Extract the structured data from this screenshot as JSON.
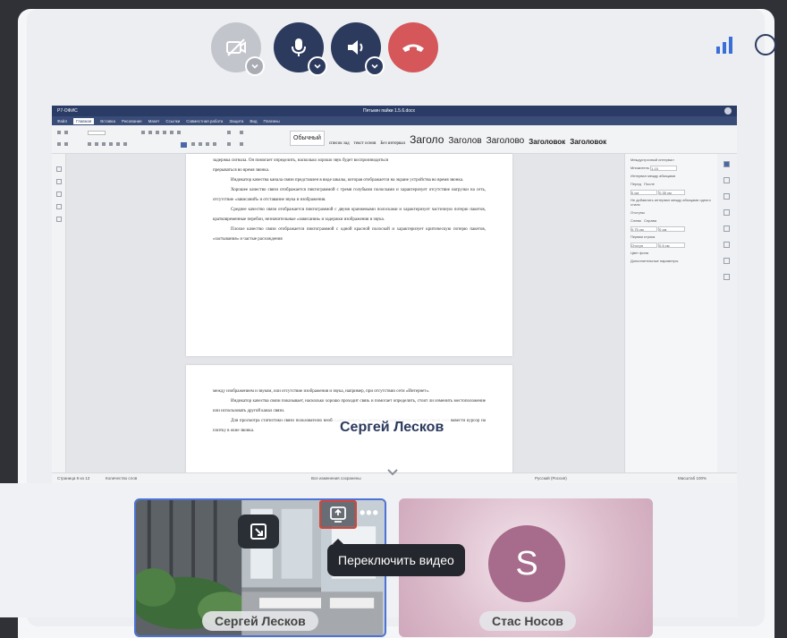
{
  "controls": {
    "camera": {
      "icon": "camera-off-icon",
      "state": "off"
    },
    "microphone": {
      "icon": "microphone-icon"
    },
    "speaker": {
      "icon": "speaker-icon"
    },
    "end_call": {
      "icon": "hang-up-icon",
      "color": "#d5575a"
    },
    "accent_color": "#2c3a5e"
  },
  "document": {
    "app": "Р7-ОФИС",
    "file_name": "Пятькин пайки 1.5.6.docx",
    "menu": [
      "Файл",
      "Главная",
      "Вставка",
      "Рисование",
      "Макет",
      "Ссылки",
      "Совместная работа",
      "Защита",
      "Вид",
      "Плагины"
    ],
    "active_menu": "Главная",
    "styles": [
      "Обычный",
      "список зад",
      "текст основ",
      "Без интервал",
      "Заголо",
      "Заголов",
      "Заголово",
      "Заголовок",
      "Заголовок"
    ],
    "page1": [
      "задержка сигнала. Он помогает определить, насколько хорошо звук будет воспроизводиться",
      "прерываться во время звонка.",
      "Индикатор качества канала связи представлен в виде шкалы, которая отображается на экране устройства во время звонка.",
      "Хорошее качество связи отображается пиктограммой с тремя голубыми полосками и характеризует отсутствие нагрузки на сеть, отсутствие «зависаний» и отставание звука и изображения.",
      "Среднее качество связи отображается пиктограммой с двумя оранжевыми полосками и характеризует частичную потерю пакетов, кратковременные перебои, незначительные «зависания» и задержки изображения и звука.",
      "Плохое качество связи отображается пиктограммой с одной красной полоской и характеризует критическую потерю пакетов, «застывания» и частые расхождения"
    ],
    "page2": [
      "между изображением и звуком, или отсутствие изображения и звука, например, при отсутствии сети «Интернет».",
      "Индикатор качества связи показывает, насколько хорошо проходит связь и помогает определить, стоит ли изменить местоположение или использовать другой канал связи.",
      "Для просмотра статистики связи пользователю необходимо нажать на значок с индикатором качества связи или навести курсор на плитку в окне звонка."
    ],
    "right_panel": [
      "Междустрочный интервал",
      "Множитель",
      "1.15",
      "Интервал между абзацами",
      "Перед",
      "После",
      "0 см",
      "0.35 см",
      "Не добавлять интервал между абзацами одного стиля",
      "Отступы",
      "Слева",
      "Справа",
      "0.75 см",
      "0 см",
      "Первая строка",
      "Отступ",
      "0.5 см",
      "Цвет фона",
      "Дополнительные параметры"
    ],
    "status": {
      "pages": "Страница 9 из 13",
      "words": "Количество слов",
      "saved": "Все изменения сохранены",
      "language": "Русский (Россия)",
      "zoom": "Масштаб 100%"
    }
  },
  "overlay_speaker": "Сергей Лесков",
  "participants": [
    {
      "name": "Сергей Лесков",
      "video": true,
      "selected": true
    },
    {
      "name": "Стас Носов",
      "video": false,
      "initial": "S",
      "avatar_color": "#a76b8b"
    }
  ],
  "tile_actions": {
    "expand_icon": "expand-icon",
    "switch_icon": "switch-video-icon",
    "more_icon": "more-icon",
    "more_label": "•••",
    "tooltip": "Переключить видео"
  }
}
